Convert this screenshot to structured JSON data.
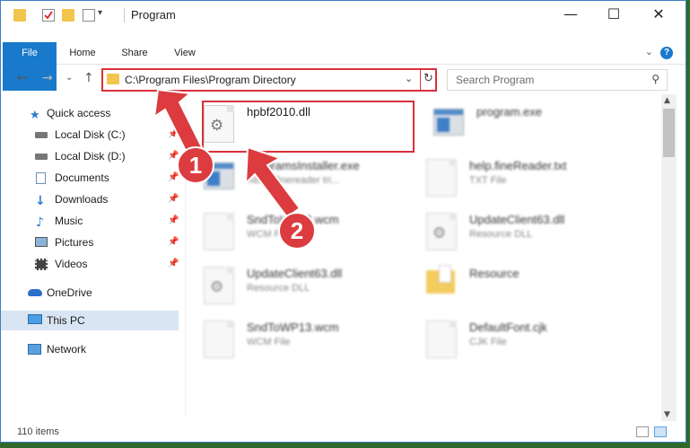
{
  "window": {
    "title": "Program",
    "minimize_glyph": "—",
    "maximize_glyph": "☐",
    "close_glyph": "✕"
  },
  "ribbon": {
    "tabs": [
      "File",
      "Home",
      "Share",
      "View"
    ],
    "help_glyph": "?",
    "expand_glyph": "⌄"
  },
  "nav": {
    "back_glyph": "←",
    "forward_glyph": "→",
    "recent_glyph": "⌄",
    "up_glyph": "↑",
    "address_path": "C:\\Program Files\\Program Directory",
    "dropdown_glyph": "⌄",
    "refresh_glyph": "↻",
    "search_placeholder": "Search Program",
    "search_glyph": "⚲"
  },
  "sidebar": {
    "items": [
      {
        "label": "Quick access",
        "icon": "star-icon",
        "pinned": false
      },
      {
        "label": "Local Disk (C:)",
        "icon": "drive-icon",
        "pinned": true
      },
      {
        "label": "Local Disk (D:)",
        "icon": "drive-icon",
        "pinned": true
      },
      {
        "label": "Documents",
        "icon": "documents-icon",
        "pinned": true
      },
      {
        "label": "Downloads",
        "icon": "download-icon",
        "pinned": true
      },
      {
        "label": "Music",
        "icon": "music-icon",
        "pinned": true
      },
      {
        "label": "Pictures",
        "icon": "pictures-icon",
        "pinned": true
      },
      {
        "label": "Videos",
        "icon": "videos-icon",
        "pinned": true
      },
      {
        "label": "OneDrive",
        "icon": "onedrive-icon",
        "pinned": false
      },
      {
        "label": "This PC",
        "icon": "computer-icon",
        "pinned": false,
        "selected": true
      },
      {
        "label": "Network",
        "icon": "network-icon",
        "pinned": false
      }
    ],
    "pin_glyph": "📌"
  },
  "files": [
    {
      "name": "hpbf2010.dll",
      "type": "",
      "icon": "dll-file-icon",
      "highlighted": true
    },
    {
      "name": "program.exe",
      "type": "",
      "icon": "exe-icon"
    },
    {
      "name": "ProgramsInstaller.exe",
      "type": "ABBY finereader tri...",
      "icon": "exe-icon"
    },
    {
      "name": "help.fineReader.txt",
      "type": "TXT File",
      "icon": "txt-file-icon"
    },
    {
      "name": "SndToWP13.wcm",
      "type": "WCM File",
      "icon": "file-icon"
    },
    {
      "name": "UpdateClient63.dll",
      "type": "Resource DLL",
      "icon": "dll-file-icon"
    },
    {
      "name": "UpdateClient63.dll",
      "type": "Resource DLL",
      "icon": "dll-file-icon"
    },
    {
      "name": "Resource",
      "type": "",
      "icon": "folder-icon"
    },
    {
      "name": "SndToWP13.wcm",
      "type": "WCM File",
      "icon": "file-icon"
    },
    {
      "name": "DefaultFont.cjk",
      "type": "CJK File",
      "icon": "file-icon"
    }
  ],
  "status": {
    "item_count": "110 items"
  },
  "callouts": [
    "1",
    "2"
  ],
  "colors": {
    "accent": "#1979ca",
    "highlight_red": "#dc3c3f",
    "folder_yellow": "#f2c64d"
  }
}
